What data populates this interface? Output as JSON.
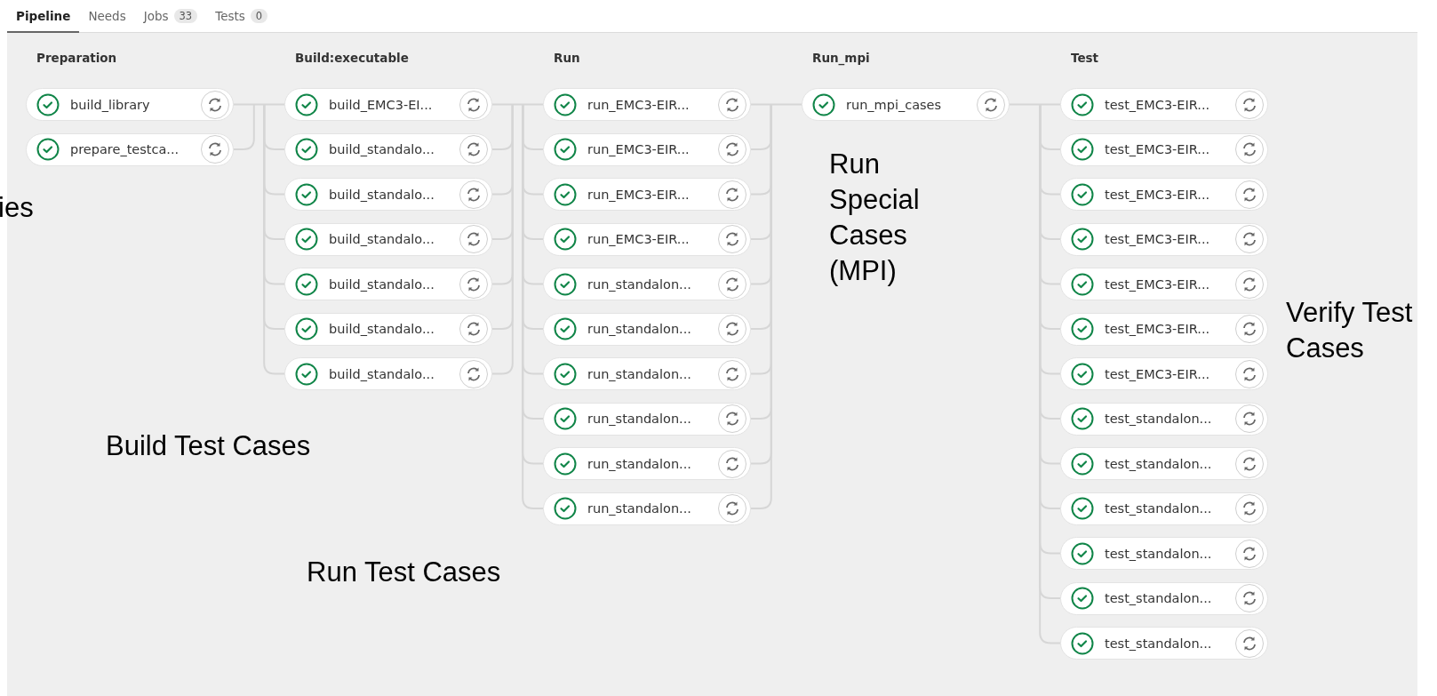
{
  "tabs": [
    {
      "label": "Pipeline",
      "selected": true
    },
    {
      "label": "Needs",
      "selected": false
    },
    {
      "label": "Jobs",
      "count": "33",
      "selected": false
    },
    {
      "label": "Tests",
      "count": "0",
      "selected": false
    }
  ],
  "stages": [
    {
      "name": "Preparation",
      "jobs": [
        {
          "name": "build_library",
          "passed": true
        },
        {
          "name": "prepare_testca...",
          "passed": true
        }
      ]
    },
    {
      "name": "Build:executable",
      "jobs": [
        {
          "name": "build_EMC3-EI...",
          "passed": true
        },
        {
          "name": "build_standalo...",
          "passed": true
        },
        {
          "name": "build_standalo...",
          "passed": true
        },
        {
          "name": "build_standalo...",
          "passed": true
        },
        {
          "name": "build_standalo...",
          "passed": true
        },
        {
          "name": "build_standalo...",
          "passed": true
        },
        {
          "name": "build_standalo...",
          "passed": true
        }
      ]
    },
    {
      "name": "Run",
      "jobs": [
        {
          "name": "run_EMC3-EIR...",
          "passed": true
        },
        {
          "name": "run_EMC3-EIR...",
          "passed": true
        },
        {
          "name": "run_EMC3-EIR...",
          "passed": true
        },
        {
          "name": "run_EMC3-EIR...",
          "passed": true
        },
        {
          "name": "run_standalon...",
          "passed": true
        },
        {
          "name": "run_standalon...",
          "passed": true
        },
        {
          "name": "run_standalon...",
          "passed": true
        },
        {
          "name": "run_standalon...",
          "passed": true
        },
        {
          "name": "run_standalon...",
          "passed": true
        },
        {
          "name": "run_standalon...",
          "passed": true
        }
      ]
    },
    {
      "name": "Run_mpi",
      "jobs": [
        {
          "name": "run_mpi_cases",
          "passed": true
        }
      ]
    },
    {
      "name": "Test",
      "jobs": [
        {
          "name": "test_EMC3-EIR...",
          "passed": true
        },
        {
          "name": "test_EMC3-EIR...",
          "passed": true
        },
        {
          "name": "test_EMC3-EIR...",
          "passed": true
        },
        {
          "name": "test_EMC3-EIR...",
          "passed": true
        },
        {
          "name": "test_EMC3-EIR...",
          "passed": true
        },
        {
          "name": "test_EMC3-EIR...",
          "passed": true
        },
        {
          "name": "test_EMC3-EIR...",
          "passed": true
        },
        {
          "name": "test_standalon...",
          "passed": true
        },
        {
          "name": "test_standalon...",
          "passed": true
        },
        {
          "name": "test_standalon...",
          "passed": true
        },
        {
          "name": "test_standalon...",
          "passed": true
        },
        {
          "name": "test_standalon...",
          "passed": true
        },
        {
          "name": "test_standalon...",
          "passed": true
        }
      ]
    }
  ],
  "annotations": [
    {
      "text": "ies"
    },
    {
      "text": "Build Test Cases"
    },
    {
      "text": "Run Test Cases"
    },
    {
      "text": "Run Special Cases (MPI)"
    },
    {
      "text": "Verify Test Cases"
    }
  ]
}
